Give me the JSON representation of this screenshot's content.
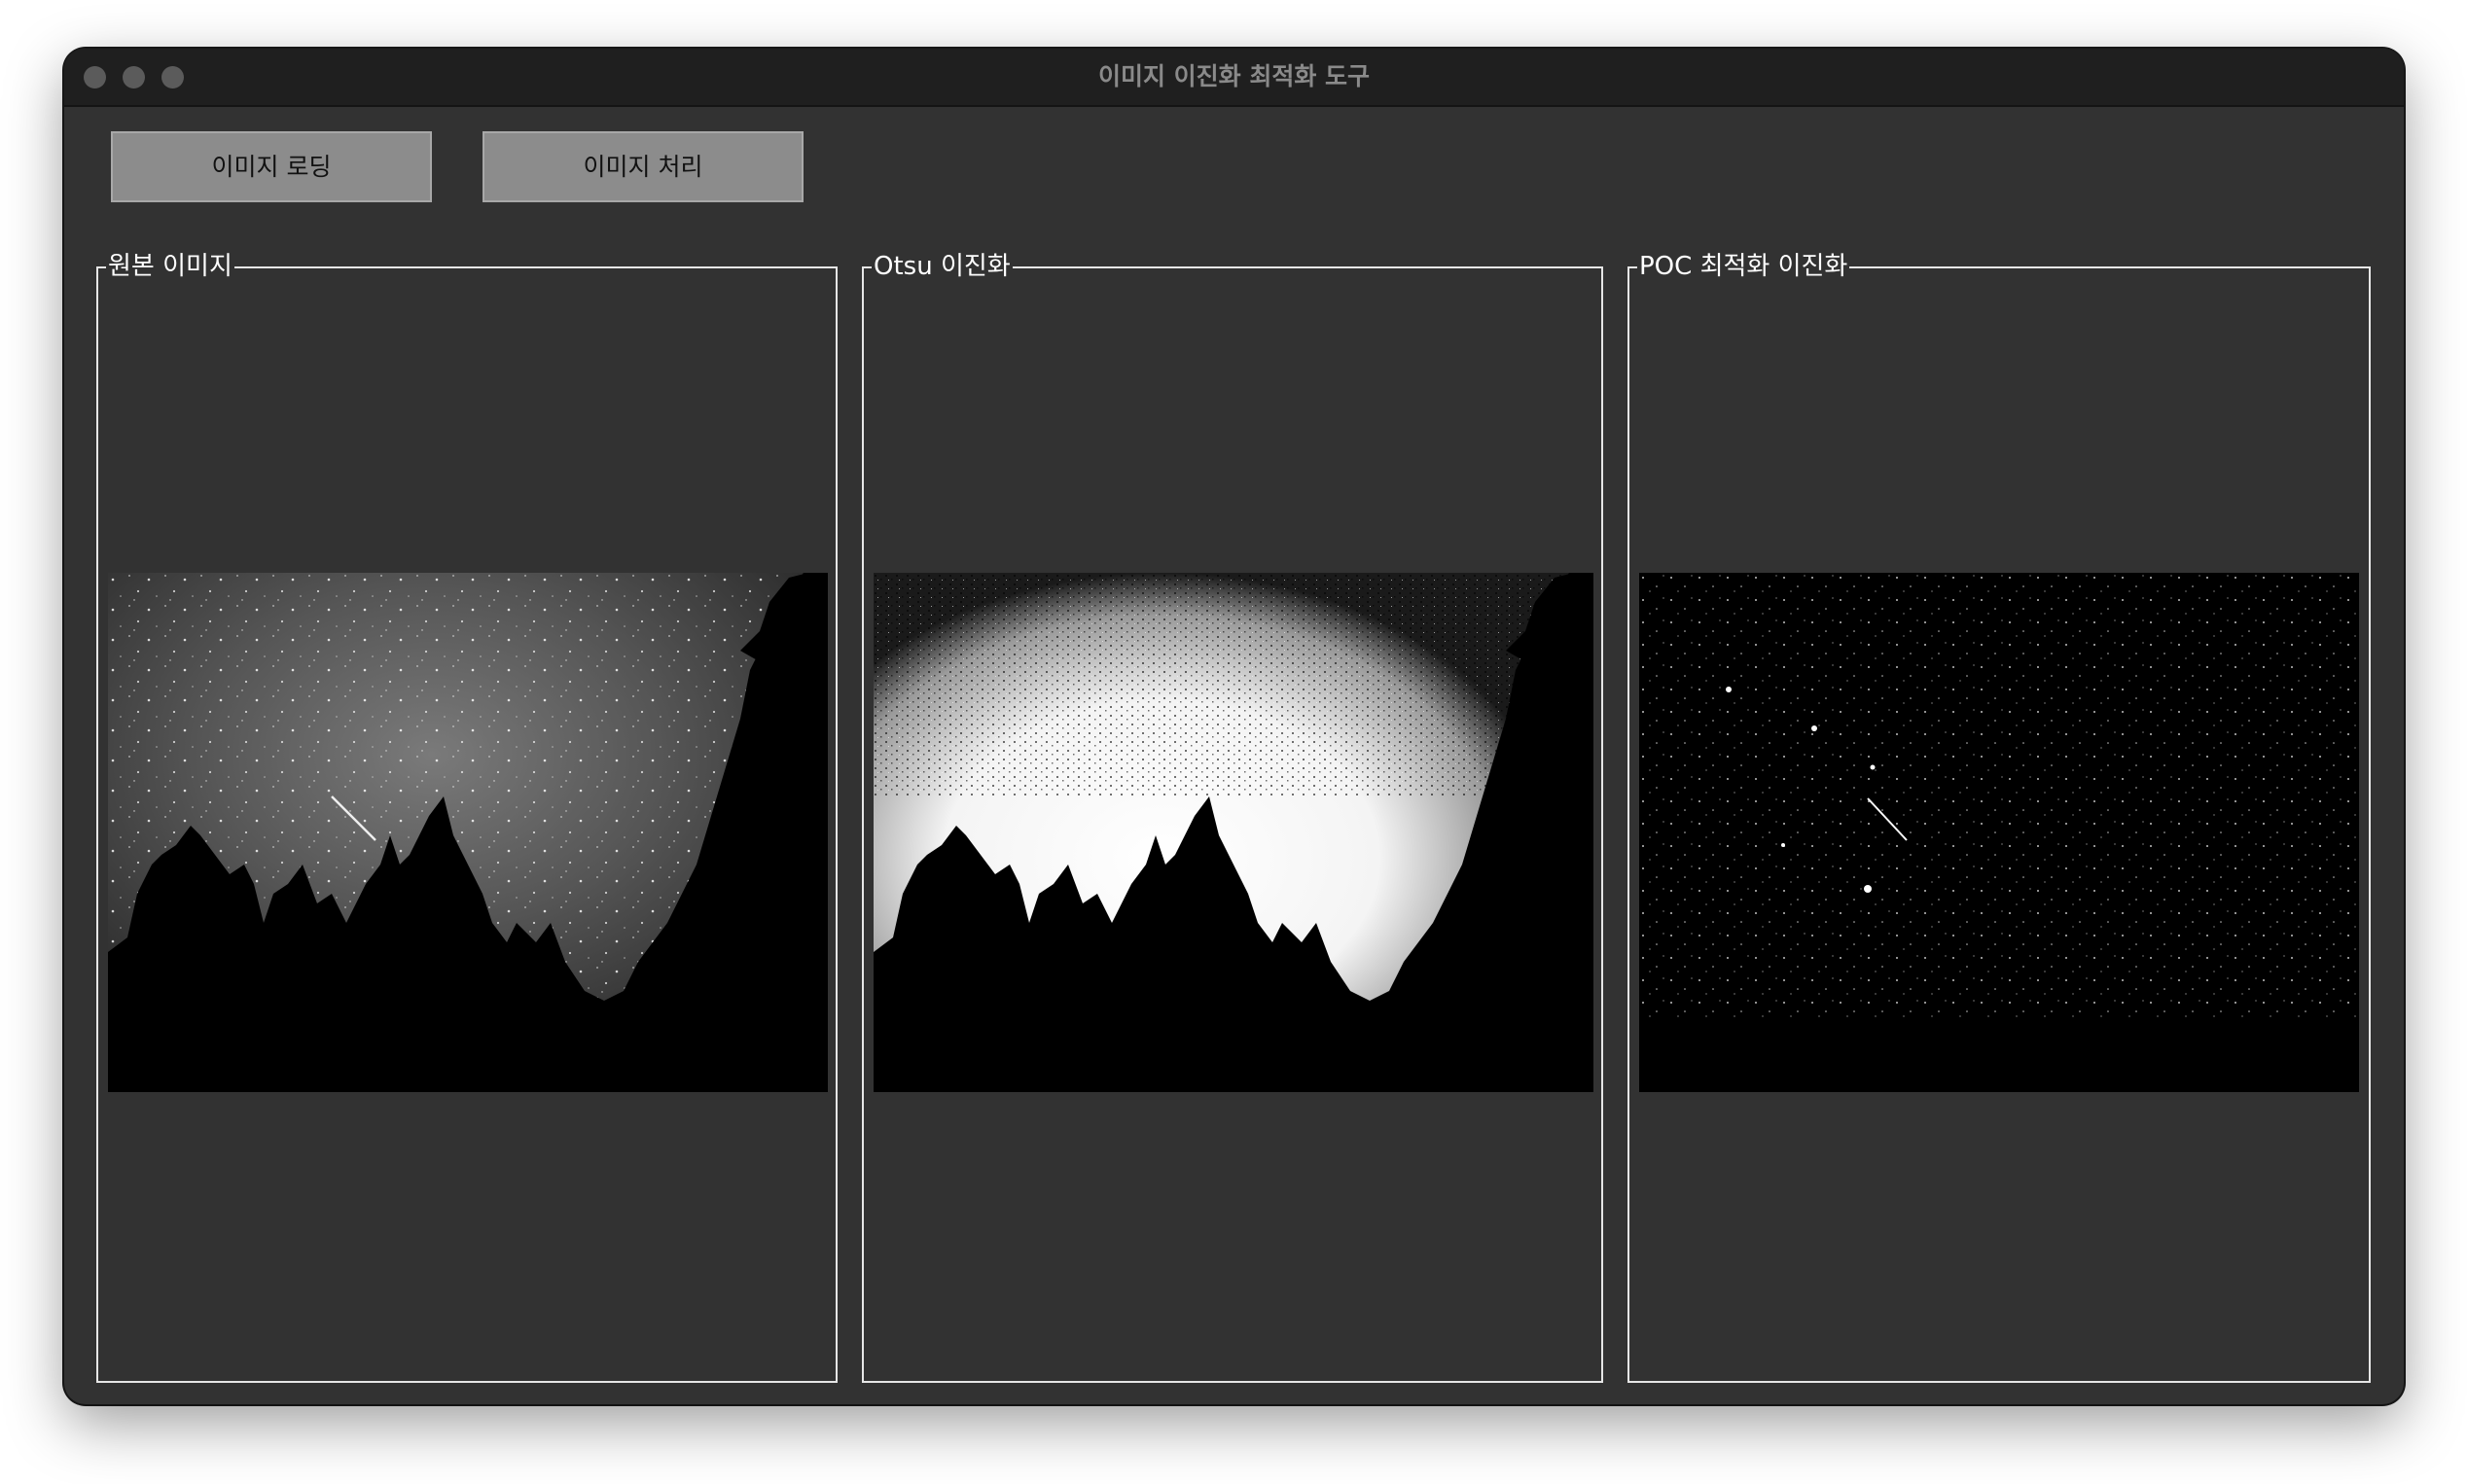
{
  "window": {
    "title": "이미지 이진화 최적화 도구"
  },
  "toolbar": {
    "load_label": "이미지 로딩",
    "process_label": "이미지 처리"
  },
  "panels": [
    {
      "title": "원본 이미지",
      "image": "night-sky-grayscale"
    },
    {
      "title": "Otsu 이진화",
      "image": "night-sky-otsu-binary"
    },
    {
      "title": "POC 최적화 이진화",
      "image": "night-sky-poc-binary"
    }
  ],
  "colors": {
    "window_bg": "#323232",
    "titlebar_bg": "#1f1f1f",
    "button_bg": "#8c8c8c",
    "frame_border": "#e6e6e6"
  }
}
